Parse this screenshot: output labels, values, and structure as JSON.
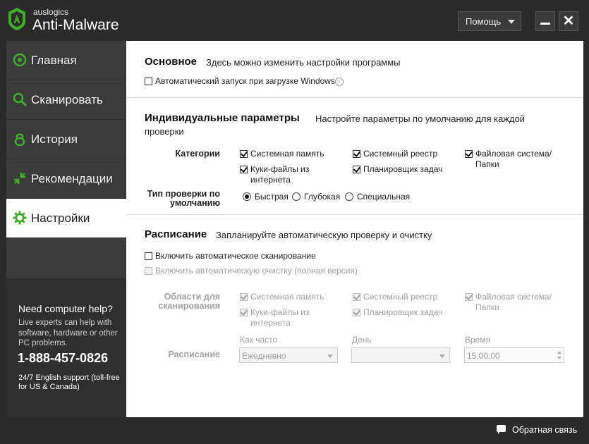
{
  "app": {
    "brand_small": "auslogics",
    "brand_name": "Anti-Malware",
    "help_label": "Помощь",
    "close_glyph": "✕",
    "accent_color": "#3fae29"
  },
  "sidebar": {
    "items": [
      {
        "label": "Главная",
        "icon": "home-circle-icon",
        "active": false
      },
      {
        "label": "Сканировать",
        "icon": "search-icon",
        "active": false
      },
      {
        "label": "История",
        "icon": "lock-icon",
        "active": false
      },
      {
        "label": "Рекомендации",
        "icon": "recommend-arrows-icon",
        "active": false
      },
      {
        "label": "Настройки",
        "icon": "gear-icon",
        "active": true
      }
    ],
    "help": {
      "title": "Need computer help?",
      "text": "Live experts can help with software, hardware or other PC problems.",
      "phone": "1-888-457-0826",
      "sub": "24/7 English support (toll-free for US & Canada)"
    }
  },
  "basic": {
    "title": "Основное",
    "desc": "Здесь можно изменить настройки программы",
    "autostart_label": "Автоматический запуск при загрузке Windows",
    "autostart_checked": false,
    "info_glyph": "i"
  },
  "individual": {
    "title": "Индивидуальные параметры",
    "desc_line1": "Настройте параметры по умолчанию для каждой",
    "desc_line2": "проверки",
    "categories_label": "Категории",
    "categories": [
      {
        "label": "Системная память",
        "checked": true
      },
      {
        "label": "Системный реестр",
        "checked": true
      },
      {
        "label": "Файловая система/ Папки",
        "checked": true
      },
      {
        "label": "Куки-файлы из интернета",
        "checked": true
      },
      {
        "label": "Планировщик задач",
        "checked": true
      }
    ],
    "scan_type_label": "Тип проверки по умолчанию",
    "scan_types": [
      {
        "label": "Быстрая",
        "selected": true
      },
      {
        "label": "Глубокая",
        "selected": false
      },
      {
        "label": "Специальная",
        "selected": false
      }
    ]
  },
  "schedule": {
    "title": "Расписание",
    "desc": "Запланируйте автоматическую проверку и очистку",
    "enable_scan_label": "Включить автоматическое сканирование",
    "enable_scan_checked": false,
    "enable_clean_label": "Включить автоматическую очистку (полная версия)",
    "enable_clean_checked": false,
    "areas_label": "Области для сканирования",
    "areas": [
      {
        "label": "Системная память",
        "checked": true
      },
      {
        "label": "Системный реестр",
        "checked": true
      },
      {
        "label": "Файловая система/ Папки",
        "checked": true
      },
      {
        "label": "Куки-файлы из интернета",
        "checked": true
      },
      {
        "label": "Планировщик задач",
        "checked": true
      }
    ],
    "schedule_label": "Расписание",
    "how_often_label": "Как часто",
    "how_often_value": "Ежедневно",
    "day_label": "День",
    "day_value": "",
    "time_label": "Время",
    "time_value": "15:00:00"
  },
  "footer": {
    "feedback_label": "Обратная связь"
  }
}
